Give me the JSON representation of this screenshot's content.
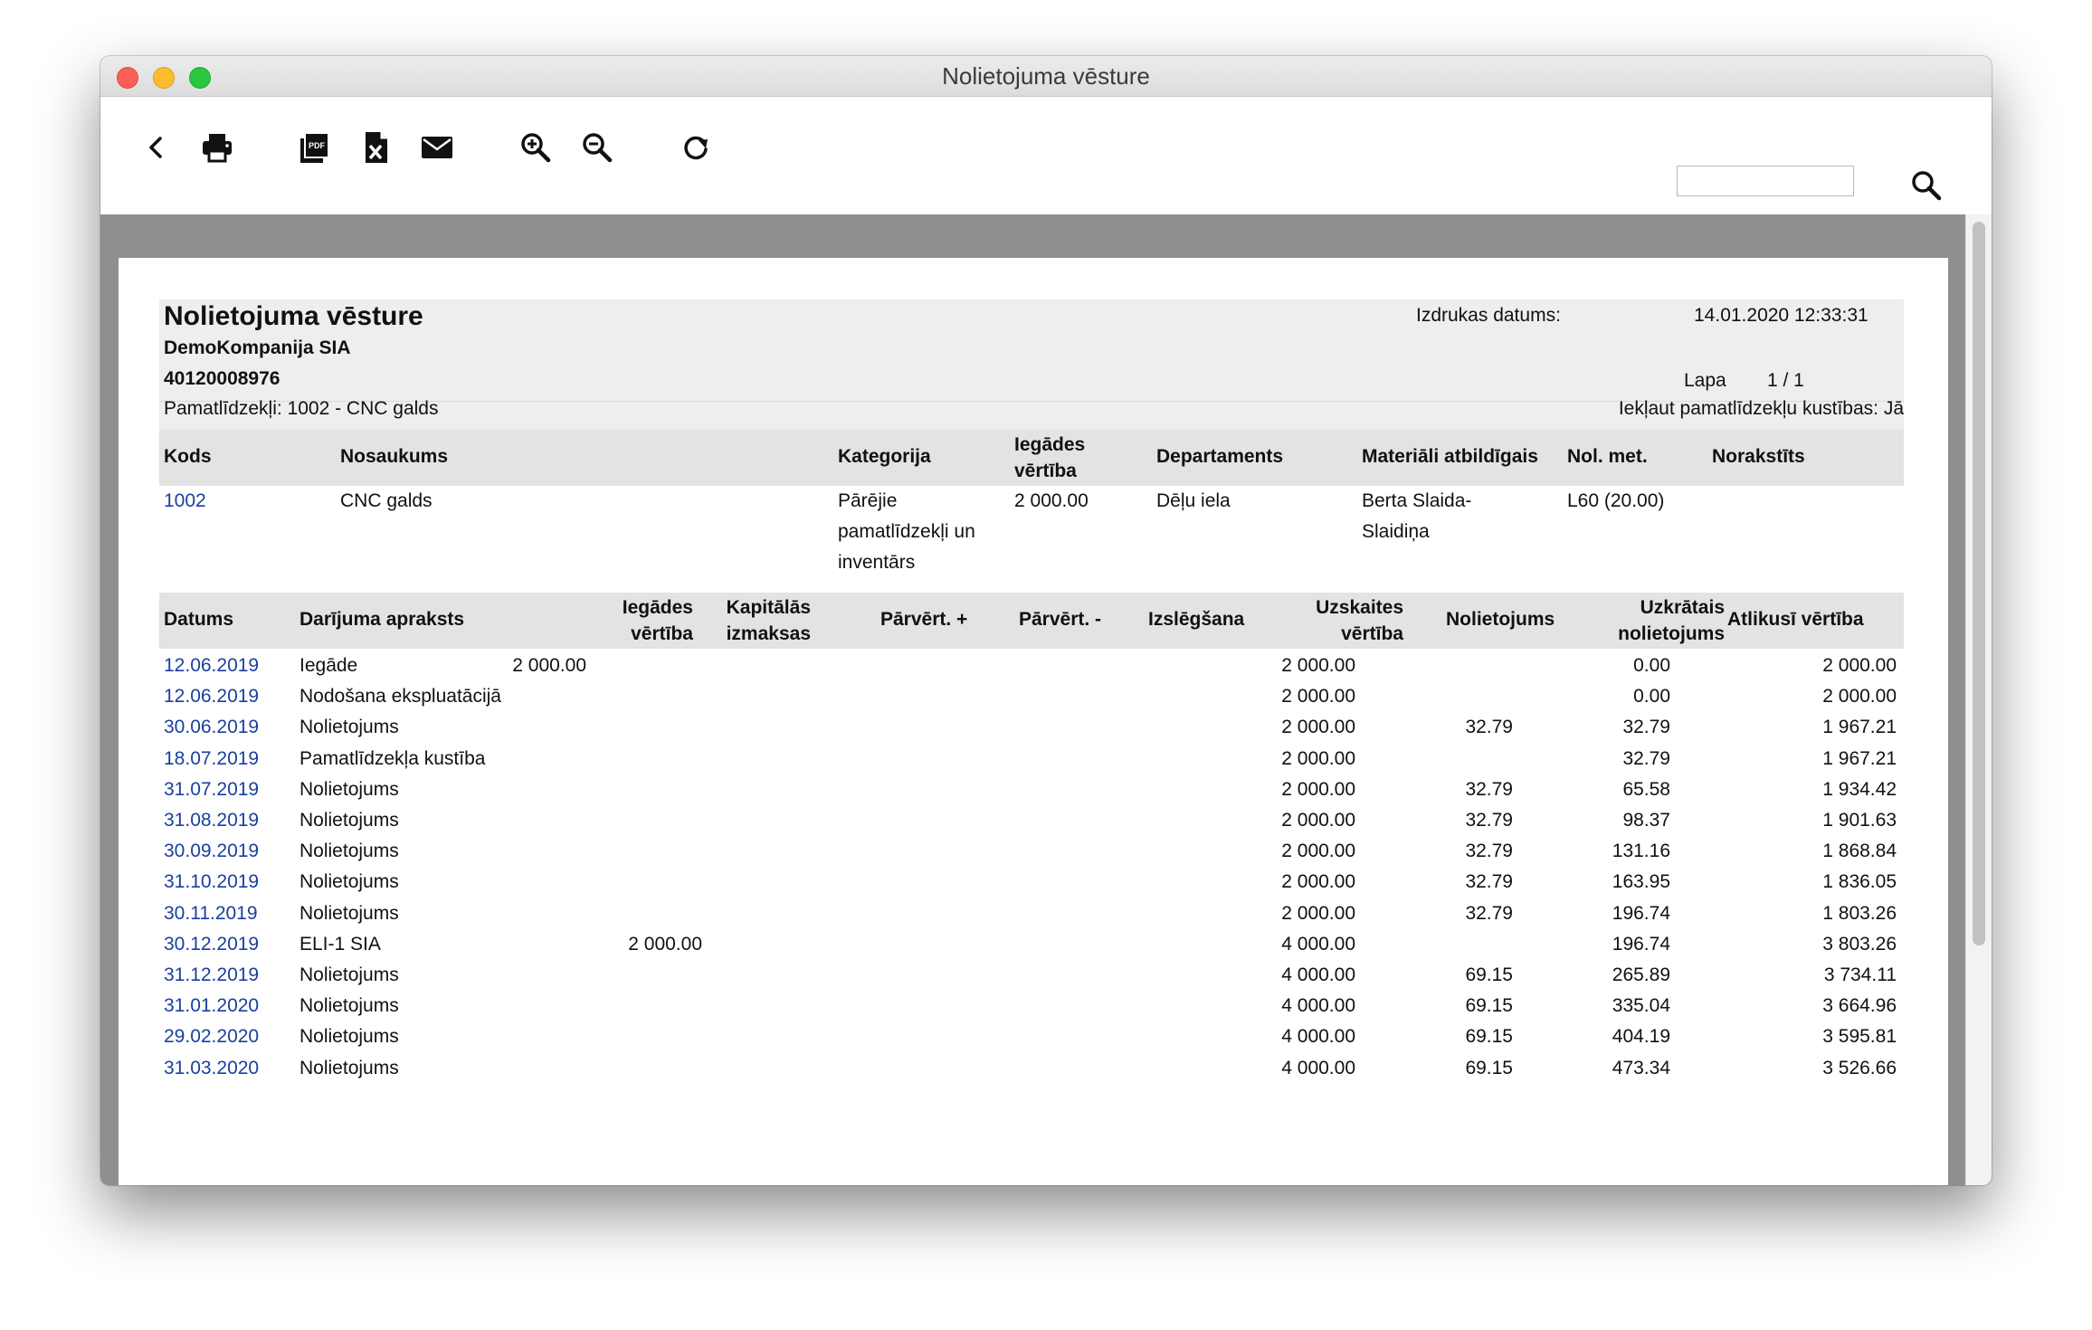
{
  "window": {
    "title": "Nolietojuma vēsture"
  },
  "toolbar": {
    "icons": [
      "chevron-left-icon",
      "printer-icon",
      "pdf-icon",
      "excel-icon",
      "envelope-icon",
      "zoom-in-icon",
      "zoom-out-icon",
      "refresh-icon",
      "search-icon"
    ],
    "search_value": ""
  },
  "report": {
    "title": "Nolietojuma vēsture",
    "company": "DemoKompanija SIA",
    "reg_no": "40120008976",
    "filter": "Pamatlīdzekļi: 1002 - CNC galds",
    "print_date_label": "Izdrukas datums:",
    "print_date_value": "14.01.2020 12:33:31",
    "page_label": "Lapa",
    "page_value": "1 / 1",
    "include_movements": "Iekļaut pamatlīdzekļu kustības: Jā"
  },
  "asset_table": {
    "headers": {
      "code": "Kods",
      "name": "Nosaukums",
      "category": "Kategorija",
      "acq_value": "Iegādes vērtība",
      "department": "Departaments",
      "responsible": "Materiāli atbildīgais",
      "dep_method": "Nol. met.",
      "written_off": "Norakstīts"
    },
    "row": {
      "code": "1002",
      "name": "CNC galds",
      "category": "Pārējie pamatlīdzekļi un inventārs",
      "acq_value": "2 000.00",
      "department": "Dēļu iela",
      "responsible": "Berta Slaida-Slaidiņa",
      "dep_method": "L60 (20.00)",
      "written_off": ""
    }
  },
  "history_table": {
    "headers": {
      "date": "Datums",
      "description": "Darījuma apraksts",
      "acq_value": "Iegādes vērtība",
      "capex": "Kapitālās izmaksas",
      "reval_plus": "Pārvērt. +",
      "reval_minus": "Pārvērt. -",
      "exclusion": "Izslēgšana",
      "book_value": "Uzskaites vērtība",
      "depreciation": "Nolietojums",
      "accum_dep": "Uzkrātais nolietojums",
      "residual": "Atlikusī vērtība"
    },
    "rows": [
      {
        "date": "12.06.2019",
        "description": "Iegāde",
        "acq_value": "2 000.00",
        "capex": "",
        "book_value": "2 000.00",
        "depreciation": "",
        "accum_dep": "0.00",
        "residual": "2 000.00"
      },
      {
        "date": "12.06.2019",
        "description": "Nodošana ekspluatācijā",
        "acq_value": "",
        "capex": "",
        "book_value": "2 000.00",
        "depreciation": "",
        "accum_dep": "0.00",
        "residual": "2 000.00"
      },
      {
        "date": "30.06.2019",
        "description": "Nolietojums",
        "acq_value": "",
        "capex": "",
        "book_value": "2 000.00",
        "depreciation": "32.79",
        "accum_dep": "32.79",
        "residual": "1 967.21"
      },
      {
        "date": "18.07.2019",
        "description": "Pamatlīdzekļa kustība",
        "acq_value": "",
        "capex": "",
        "book_value": "2 000.00",
        "depreciation": "",
        "accum_dep": "32.79",
        "residual": "1 967.21"
      },
      {
        "date": "31.07.2019",
        "description": "Nolietojums",
        "acq_value": "",
        "capex": "",
        "book_value": "2 000.00",
        "depreciation": "32.79",
        "accum_dep": "65.58",
        "residual": "1 934.42"
      },
      {
        "date": "31.08.2019",
        "description": "Nolietojums",
        "acq_value": "",
        "capex": "",
        "book_value": "2 000.00",
        "depreciation": "32.79",
        "accum_dep": "98.37",
        "residual": "1 901.63"
      },
      {
        "date": "30.09.2019",
        "description": "Nolietojums",
        "acq_value": "",
        "capex": "",
        "book_value": "2 000.00",
        "depreciation": "32.79",
        "accum_dep": "131.16",
        "residual": "1 868.84"
      },
      {
        "date": "31.10.2019",
        "description": "Nolietojums",
        "acq_value": "",
        "capex": "",
        "book_value": "2 000.00",
        "depreciation": "32.79",
        "accum_dep": "163.95",
        "residual": "1 836.05"
      },
      {
        "date": "30.11.2019",
        "description": "Nolietojums",
        "acq_value": "",
        "capex": "",
        "book_value": "2 000.00",
        "depreciation": "32.79",
        "accum_dep": "196.74",
        "residual": "1 803.26"
      },
      {
        "date": "30.12.2019",
        "description": "ELI-1 SIA",
        "acq_value": "",
        "capex": "2 000.00",
        "book_value": "4 000.00",
        "depreciation": "",
        "accum_dep": "196.74",
        "residual": "3 803.26"
      },
      {
        "date": "31.12.2019",
        "description": "Nolietojums",
        "acq_value": "",
        "capex": "",
        "book_value": "4 000.00",
        "depreciation": "69.15",
        "accum_dep": "265.89",
        "residual": "3 734.11"
      },
      {
        "date": "31.01.2020",
        "description": "Nolietojums",
        "acq_value": "",
        "capex": "",
        "book_value": "4 000.00",
        "depreciation": "69.15",
        "accum_dep": "335.04",
        "residual": "3 664.96"
      },
      {
        "date": "29.02.2020",
        "description": "Nolietojums",
        "acq_value": "",
        "capex": "",
        "book_value": "4 000.00",
        "depreciation": "69.15",
        "accum_dep": "404.19",
        "residual": "3 595.81"
      },
      {
        "date": "31.03.2020",
        "description": "Nolietojums",
        "acq_value": "",
        "capex": "",
        "book_value": "4 000.00",
        "depreciation": "69.15",
        "accum_dep": "473.34",
        "residual": "3 526.66"
      }
    ]
  }
}
